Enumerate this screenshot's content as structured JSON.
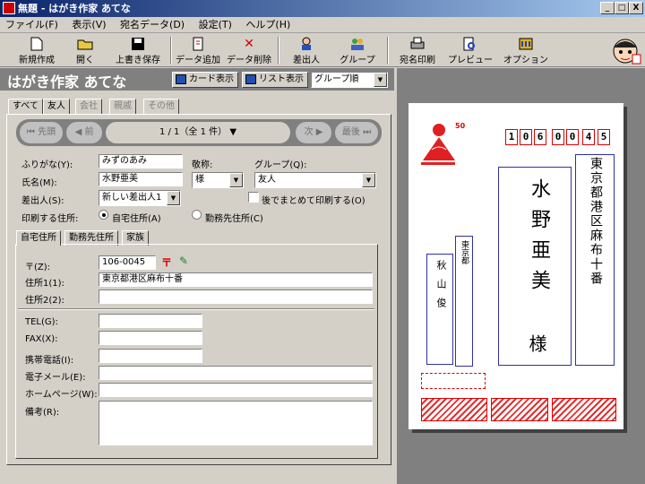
{
  "window": {
    "title": "無題 - はがき作家 あてな",
    "min": "_",
    "max": "□",
    "close": "X"
  },
  "menu": [
    "ファイル(F)",
    "表示(V)",
    "宛名データ(D)",
    "設定(T)",
    "ヘルプ(H)"
  ],
  "toolbar": {
    "new": "新規作成",
    "open": "開く",
    "save": "上書き保存",
    "add": "データ追加",
    "delete": "データ削除",
    "sender": "差出人",
    "group": "グループ",
    "print": "宛名印刷",
    "preview": "プレビュー",
    "options": "オプション"
  },
  "header": {
    "title": "はがき作家 あてな",
    "card_view": "カード表示",
    "list_view": "リスト表示",
    "sort": "グループ順"
  },
  "tabs": [
    "すべて",
    "友人",
    "会社",
    "親戚",
    "その他"
  ],
  "nav": {
    "first": "先頭",
    "prev": "前",
    "counter": "1 / 1（全 1 件）",
    "next": "次",
    "last": "最後"
  },
  "form": {
    "furigana_label": "ふりがな(Y):",
    "furigana": "みずのあみ",
    "honorific_label": "敬称:",
    "honorific": "様",
    "group_label": "グループ(Q):",
    "group": "友人",
    "name_label": "氏名(M):",
    "name": "水野亜美",
    "sender_label": "差出人(S):",
    "sender": "新しい差出人1",
    "later_print": "後でまとめて印刷する(O)",
    "print_addr_label": "印刷する住所:",
    "home_addr": "自宅住所(A)",
    "work_addr": "勤務先住所(C)"
  },
  "subtabs": [
    "自宅住所",
    "勤務先住所",
    "家族"
  ],
  "address": {
    "zip_label": "〒(Z):",
    "zip": "106-0045",
    "addr1_label": "住所1(1):",
    "addr1": "東京都港区麻布十番",
    "addr2_label": "住所2(2):",
    "addr2": "",
    "tel_label": "TEL(G):",
    "fax_label": "FAX(X):",
    "mobile_label": "携帯電話(I):",
    "email_label": "電子メール(E):",
    "homepage_label": "ホームページ(W):",
    "memo_label": "備考(R):"
  },
  "card": {
    "zip_digits": [
      "1",
      "0",
      "6",
      "0",
      "0",
      "4",
      "5"
    ],
    "stamp_value": "50",
    "recipient_name": "水野亜美",
    "honorific": "様",
    "address": "東京都港区麻布十番",
    "sender_name": "秋山俊",
    "sender_addr": "東京都"
  }
}
